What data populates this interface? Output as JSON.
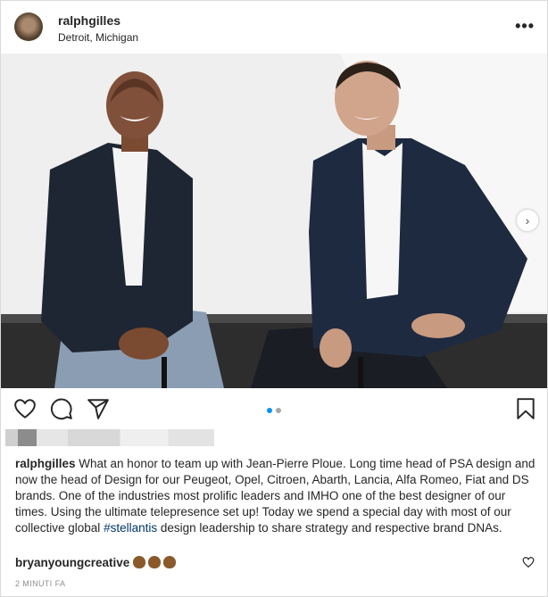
{
  "header": {
    "username": "ralphgilles",
    "location": "Detroit, Michigan",
    "more_label": "•••",
    "avatar_icon": "profile-avatar"
  },
  "carousel": {
    "next_icon": "chevron-right-icon",
    "next_label": "›",
    "slide_count": 2,
    "active_slide": 1
  },
  "actions": {
    "icons": [
      "heart-icon",
      "comment-icon",
      "share-icon",
      "bookmark-icon"
    ]
  },
  "caption": {
    "username": "ralphgilles",
    "text_before": " What an honor to team up with Jean-Pierre Ploue. Long time head of PSA design and now the head of Design for our Peugeot, Opel, Citroen, Abarth, Lancia, Alfa Romeo, Fiat and DS brands. One of the industries most prolific leaders and IMHO one of the best designer of our times. Using the ultimate telepresence set up! Today we spend a special day with most of our collective global ",
    "hashtag": "#stellantis",
    "text_after": " design leadership to share strategy and respective brand DNAs."
  },
  "comment": {
    "username": "bryanyoungcreative",
    "emoji_icons": [
      "clap-icon",
      "clap-icon",
      "clap-icon"
    ]
  },
  "timestamp": "2 MINUTI FA",
  "colors": {
    "accent": "#0095f6",
    "text": "#262626",
    "muted": "#8e8e8e",
    "hashtag": "#00376b",
    "border": "#dbdbdb"
  }
}
